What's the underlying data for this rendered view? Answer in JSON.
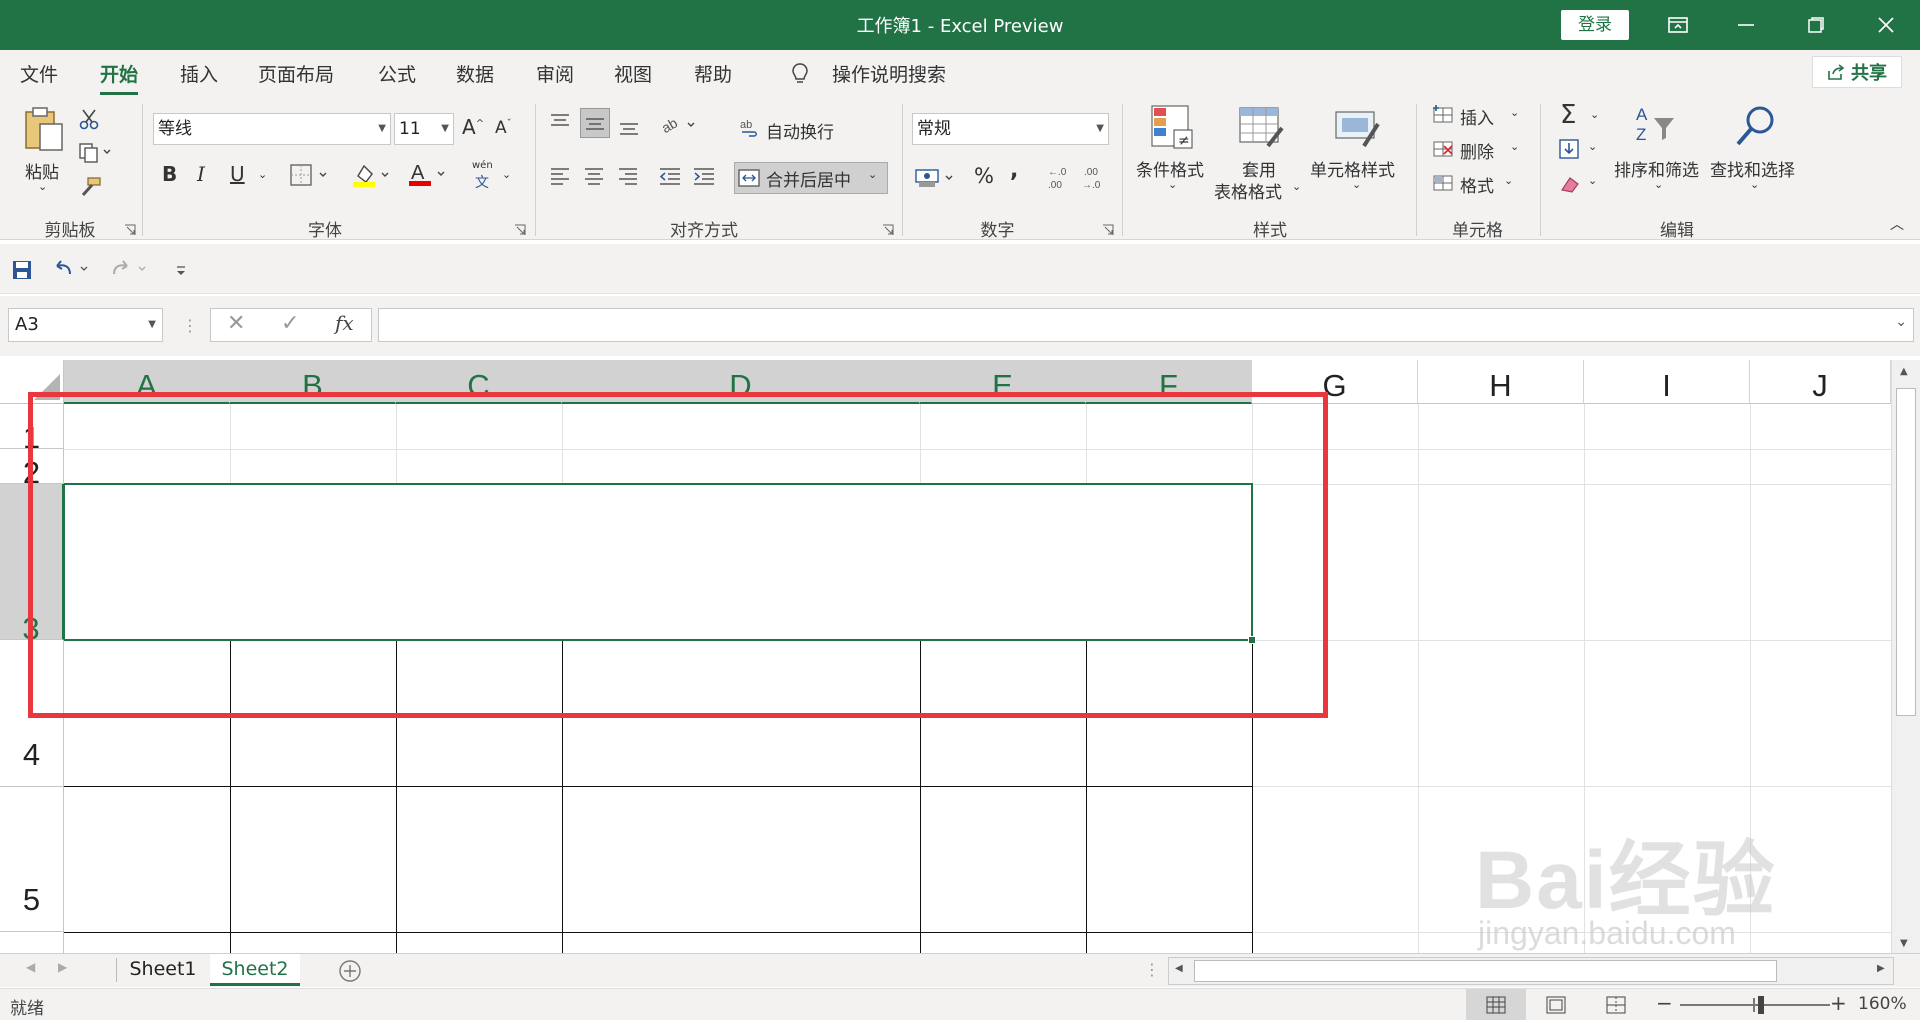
{
  "titlebar": {
    "title": "工作簿1  -  Excel Preview",
    "login": "登录",
    "bg_color": "#217346"
  },
  "tabs": {
    "items": [
      "文件",
      "开始",
      "插入",
      "页面布局",
      "公式",
      "数据",
      "审阅",
      "视图",
      "帮助"
    ],
    "active": "开始",
    "search": "操作说明搜索",
    "share": "共享"
  },
  "ribbon": {
    "clipboard": {
      "paste": "粘贴",
      "label": "剪贴板"
    },
    "font": {
      "name": "等线",
      "size": "11",
      "label": "字体",
      "bold": "B",
      "italic": "I",
      "underline": "U",
      "phonetic_top": "wén",
      "phonetic_bottom": "文"
    },
    "alignment": {
      "wrap": "自动换行",
      "merge": "合并后居中",
      "label": "对齐方式"
    },
    "number": {
      "format": "常规",
      "percent": "%",
      "comma": ",",
      "label": "数字"
    },
    "styles": {
      "conditional": "条件格式",
      "table_line1": "套用",
      "table_line2": "表格格式",
      "cell_styles": "单元格样式",
      "label": "样式"
    },
    "cells": {
      "insert": "插入",
      "delete": "删除",
      "format": "格式",
      "label": "单元格"
    },
    "editing": {
      "sort": "排序和筛选",
      "find": "查找和选择",
      "label": "编辑"
    }
  },
  "formula": {
    "namebox": "A3",
    "fx": "fx",
    "value": ""
  },
  "grid": {
    "columns": [
      "A",
      "B",
      "C",
      "D",
      "E",
      "F",
      "G",
      "H",
      "I",
      "J"
    ],
    "selected_columns": [
      "A",
      "B",
      "C",
      "D",
      "E",
      "F"
    ],
    "rows": [
      "1",
      "2",
      "3",
      "4",
      "5"
    ],
    "selected_row": "3",
    "active_cell": "A3"
  },
  "sheets": {
    "items": [
      "Sheet1",
      "Sheet2"
    ],
    "active": "Sheet2"
  },
  "status": {
    "mode": "就绪",
    "zoom": "160%"
  },
  "watermark": {
    "text_top": "Bai经验",
    "text_bottom": "jingyan.baidu.com"
  },
  "colors": {
    "excel_green": "#217346",
    "annotation_red": "#e8383d"
  }
}
